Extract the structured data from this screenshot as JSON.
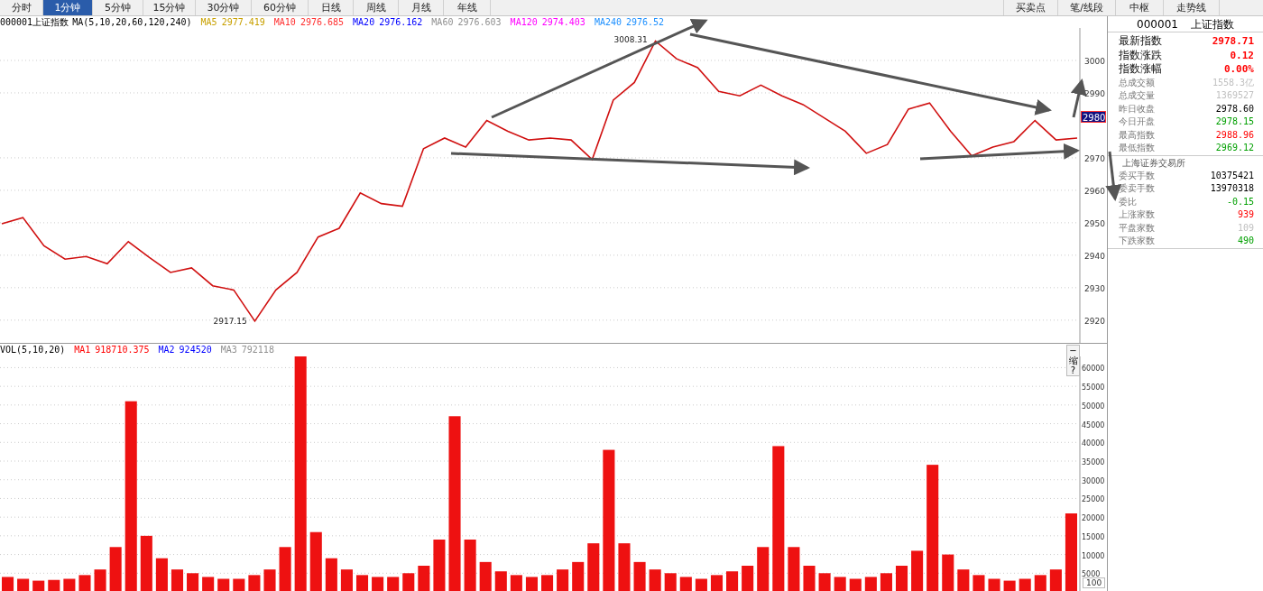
{
  "tabs": [
    {
      "label": "分时",
      "selected": false
    },
    {
      "label": "1分钟",
      "selected": true
    },
    {
      "label": "5分钟",
      "selected": false
    },
    {
      "label": "15分钟",
      "selected": false
    },
    {
      "label": "30分钟",
      "selected": false
    },
    {
      "label": "60分钟",
      "selected": false
    },
    {
      "label": "日线",
      "selected": false
    },
    {
      "label": "周线",
      "selected": false
    },
    {
      "label": "月线",
      "selected": false
    },
    {
      "label": "年线",
      "selected": false
    }
  ],
  "tools": [
    "买卖点",
    "笔/线段",
    "中枢",
    "走势线"
  ],
  "price_chart": {
    "code": "000001",
    "legend_title": "MA(5,10,20,60,120,240)",
    "legend": [
      {
        "name": "MA5",
        "value": "2977.419",
        "color": "#c8a000"
      },
      {
        "name": "MA10",
        "value": "2976.685",
        "color": "#ff3030"
      },
      {
        "name": "MA20",
        "value": "2976.162",
        "color": "#0000ff"
      },
      {
        "name": "MA60",
        "value": "2976.603",
        "color": "#909090"
      },
      {
        "name": "MA120",
        "value": "2974.403",
        "color": "#ff00ff"
      },
      {
        "name": "MA240",
        "value": "2976.52",
        "color": "#1e90ff"
      }
    ],
    "axis_marker": "2980",
    "chart_data": {
      "type": "line",
      "grid": true,
      "ylim": [
        2913,
        3010
      ],
      "yticks": [
        2920,
        2930,
        2940,
        2950,
        2960,
        2970,
        2990,
        3000
      ],
      "series": [
        {
          "name": "上证指数",
          "color": "#d01010",
          "values": [
            2949.7,
            2951.6,
            2942.9,
            2938.8,
            2939.6,
            2937.4,
            2944.2,
            2939.3,
            2934.7,
            2936.1,
            2930.6,
            2929.3,
            2919.7,
            2929.3,
            2934.7,
            2945.6,
            2948.3,
            2959.2,
            2955.9,
            2955.1,
            2972.8,
            2976.1,
            2973.3,
            2981.5,
            2978.2,
            2975.5,
            2976.1,
            2975.5,
            2969.5,
            2987.8,
            2993.2,
            3006.0,
            3000.5,
            2997.8,
            2990.5,
            2989.1,
            2992.4,
            2989.1,
            2986.4,
            2982.3,
            2978.2,
            2971.4,
            2974.1,
            2985.0,
            2986.9,
            2978.2,
            2970.6,
            2973.3,
            2975.0,
            2981.5,
            2975.5,
            2976.1
          ]
        }
      ],
      "annotations": [
        "3008.31",
        "2917.15"
      ]
    }
  },
  "volume_chart": {
    "legend_title": "(5,10,20)",
    "legend": [
      {
        "name": "MA1",
        "value": "918710.375",
        "color": "#ff0000"
      },
      {
        "name": "MA2",
        "value": "924520",
        "color": "#0000ff"
      },
      {
        "name": "MA3",
        "value": "792118",
        "color": "#909090"
      }
    ],
    "controls": [
      "−",
      "缩",
      "?"
    ],
    "axis_bottom_label": "100",
    "chart_data": {
      "type": "bar",
      "grid": true,
      "ylim": [
        0,
        63000
      ],
      "yticks": [
        5000,
        10000,
        15000,
        20000,
        25000,
        30000,
        35000,
        40000,
        45000,
        50000,
        55000,
        60000
      ],
      "series": [
        {
          "name": "VOL",
          "color": "#ee1111",
          "values": [
            4000,
            3500,
            3000,
            3200,
            3500,
            4500,
            6000,
            12000,
            51000,
            15000,
            9000,
            6000,
            5000,
            4000,
            3500,
            3500,
            4500,
            6000,
            12000,
            63000,
            16000,
            9000,
            6000,
            4500,
            4000,
            4000,
            5000,
            7000,
            14000,
            47000,
            14000,
            8000,
            5500,
            4500,
            4000,
            4500,
            6000,
            8000,
            13000,
            38000,
            13000,
            8000,
            6000,
            5000,
            4000,
            3500,
            4500,
            5500,
            7000,
            12000,
            39000,
            12000,
            7000,
            5000,
            4000,
            3500,
            4000,
            5000,
            7000,
            11000,
            34000,
            10000,
            6000,
            4500,
            3500,
            3000,
            3500,
            4500,
            6000,
            21000
          ]
        }
      ]
    }
  },
  "quote": {
    "code": "000001",
    "name": "上证指数",
    "rows": [
      {
        "kind": "major",
        "label": "最新指数",
        "value": "2978.71",
        "color": "#ff0000"
      },
      {
        "kind": "major",
        "label": "指数涨跌",
        "value": "0.12",
        "color": "#ff0000"
      },
      {
        "kind": "major",
        "label": "指数涨幅",
        "value": "0.00%",
        "color": "#ff0000"
      },
      {
        "kind": "minor",
        "label": "总成交额",
        "value": "1558.3亿",
        "color": "#c0c0c0"
      },
      {
        "kind": "minor",
        "label": "总成交量",
        "value": "1369527",
        "color": "#c0c0c0"
      },
      {
        "kind": "minor",
        "label": "昨日收盘",
        "value": "2978.60",
        "color": "#000000"
      },
      {
        "kind": "minor",
        "label": "今日开盘",
        "value": "2978.15",
        "color": "#00a000"
      },
      {
        "kind": "minor",
        "label": "最高指数",
        "value": "2988.96",
        "color": "#ff0000"
      },
      {
        "kind": "minor",
        "label": "最低指数",
        "value": "2969.12",
        "color": "#00a000"
      }
    ],
    "exchange": "上海证券交易所",
    "rows2": [
      {
        "label": "委买手数",
        "value": "10375421",
        "color": "#000000"
      },
      {
        "label": "委卖手数",
        "value": "13970318",
        "color": "#000000"
      },
      {
        "label": "委比",
        "value": "-0.15",
        "color": "#00a000"
      },
      {
        "label": "上涨家数",
        "value": "939",
        "color": "#ff0000"
      },
      {
        "label": "平盘家数",
        "value": "109",
        "color": "#c0c0c0"
      },
      {
        "label": "下跌家数",
        "value": "490",
        "color": "#00a000"
      }
    ]
  }
}
